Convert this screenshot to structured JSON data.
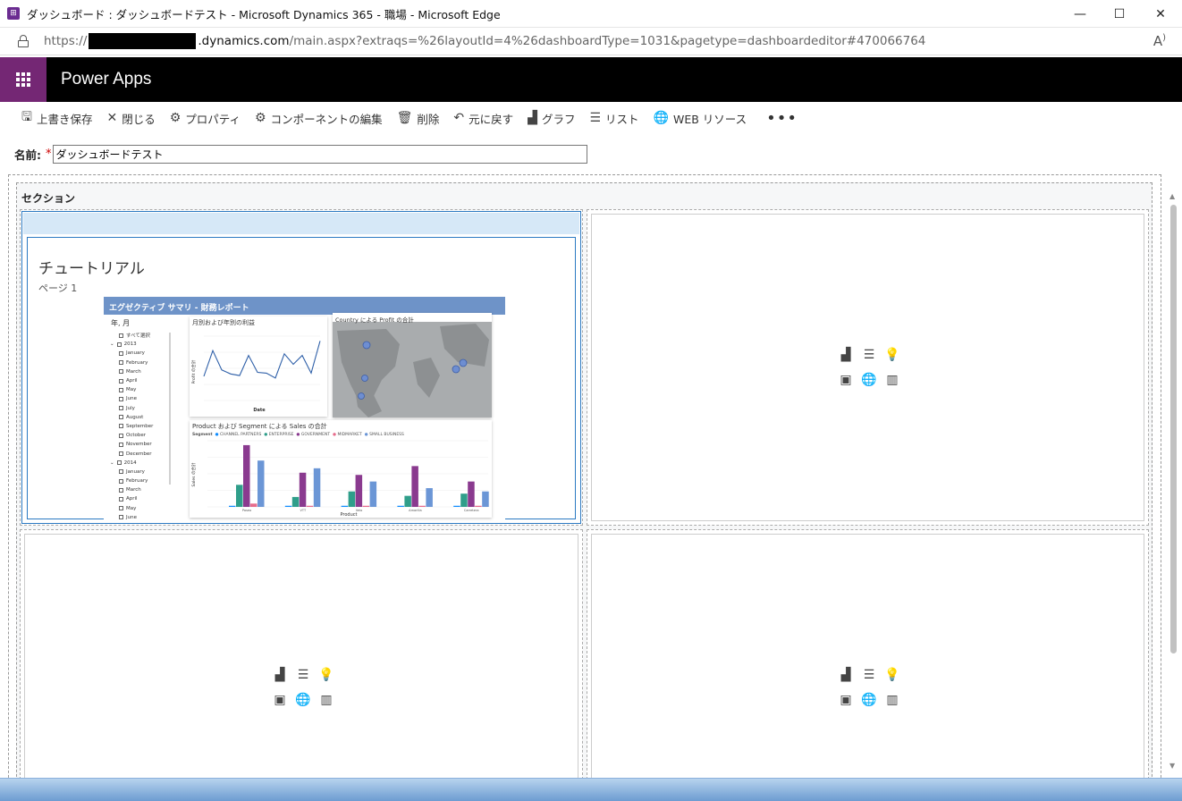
{
  "window": {
    "title": "ダッシュボード : ダッシュボードテスト - Microsoft Dynamics 365 - 職場 - Microsoft Edge",
    "minimize": "—",
    "maximize": "☐",
    "close": "✕"
  },
  "address": {
    "prefix": "https://",
    "host": ".dynamics.com",
    "path": "/main.aspx?extraqs=%26layoutId=4%26dashboardType=1031&pagetype=dashboardeditor#470066764",
    "read_aloud": "Á"
  },
  "app": {
    "title": "Power Apps"
  },
  "toolbar": {
    "items": [
      {
        "label": "上書き保存",
        "icon": "save-icon",
        "glyph": "🖫"
      },
      {
        "label": "閉じる",
        "icon": "close-icon",
        "glyph": "✕"
      },
      {
        "label": "プロパティ",
        "icon": "gear-icon",
        "glyph": "⚙"
      },
      {
        "label": "コンポーネントの編集",
        "icon": "gear-icon",
        "glyph": "⚙"
      },
      {
        "label": "削除",
        "icon": "trash-icon",
        "glyph": "🗑"
      },
      {
        "label": "元に戻す",
        "icon": "undo-icon",
        "glyph": "↶"
      },
      {
        "label": "グラフ",
        "icon": "add-chart-icon",
        "glyph": "▟"
      },
      {
        "label": "リスト",
        "icon": "list-icon",
        "glyph": "☰"
      },
      {
        "label": "WEB リソース",
        "icon": "globe-icon",
        "glyph": "🌐"
      }
    ],
    "more": "•••"
  },
  "form": {
    "name_label": "名前:",
    "required_mark": "*",
    "name_value": "ダッシュボードテスト"
  },
  "section": {
    "label": "セクション"
  },
  "report": {
    "title": "チュートリアル",
    "page": "ページ 1",
    "header": "エグゼクティブ サマリ - 財務レポート",
    "slicer": {
      "title": "年, 月",
      "items": [
        "すべて選択",
        "2013",
        "January",
        "February",
        "March",
        "April",
        "May",
        "June",
        "July",
        "August",
        "September",
        "October",
        "November",
        "December",
        "2014",
        "January",
        "February",
        "March",
        "April",
        "May",
        "June"
      ]
    },
    "line_chart": {
      "title": "月別および年別の利益",
      "xlabel": "Date",
      "ylabel": "Profit の合計"
    },
    "map": {
      "title": "Country による Profit の合計"
    },
    "bar_chart": {
      "title": "Product および Segment による Sales の合計",
      "legend_title": "Segment",
      "legend": [
        "CHANNEL PARTNERS",
        "ENTERPRISE",
        "GOVERNMENT",
        "MIDMARKET",
        "SMALL BUSINESS"
      ],
      "xlabel": "Product",
      "ylabel": "Sales の合計",
      "categories": [
        "Paseo",
        "VTT",
        "Velo",
        "Amarilla",
        "Carretera"
      ]
    }
  },
  "colors": {
    "waffle_bg": "#742774",
    "header_bg": "#000000",
    "selection": "#2b79c2",
    "series": [
      "#118dff",
      "#2f9e8a",
      "#8a3a8f",
      "#e66c8c",
      "#6b96d6"
    ]
  },
  "chart_data": [
    {
      "type": "line",
      "title": "月別および年別の利益",
      "xlabel": "Date",
      "ylabel": "Profit の合計",
      "values": [
        30,
        62,
        38,
        33,
        31,
        56,
        35,
        34,
        28,
        58,
        45,
        56,
        34,
        74
      ]
    },
    {
      "type": "bar",
      "title": "Product および Segment による Sales の合計",
      "xlabel": "Product",
      "ylabel": "Sales の合計",
      "categories": [
        "Paseo",
        "VTT",
        "Velo",
        "Amarilla",
        "Carretera"
      ],
      "series": [
        {
          "name": "CHANNEL PARTNERS",
          "values": [
            1,
            1,
            1,
            1,
            1
          ]
        },
        {
          "name": "ENTERPRISE",
          "values": [
            20,
            9,
            14,
            10,
            12
          ]
        },
        {
          "name": "GOVERNMENT",
          "values": [
            56,
            31,
            29,
            37,
            23
          ]
        },
        {
          "name": "MIDMARKET",
          "values": [
            3,
            1,
            1,
            1,
            1
          ]
        },
        {
          "name": "SMALL BUSINESS",
          "values": [
            42,
            35,
            23,
            17,
            14
          ]
        }
      ]
    }
  ]
}
